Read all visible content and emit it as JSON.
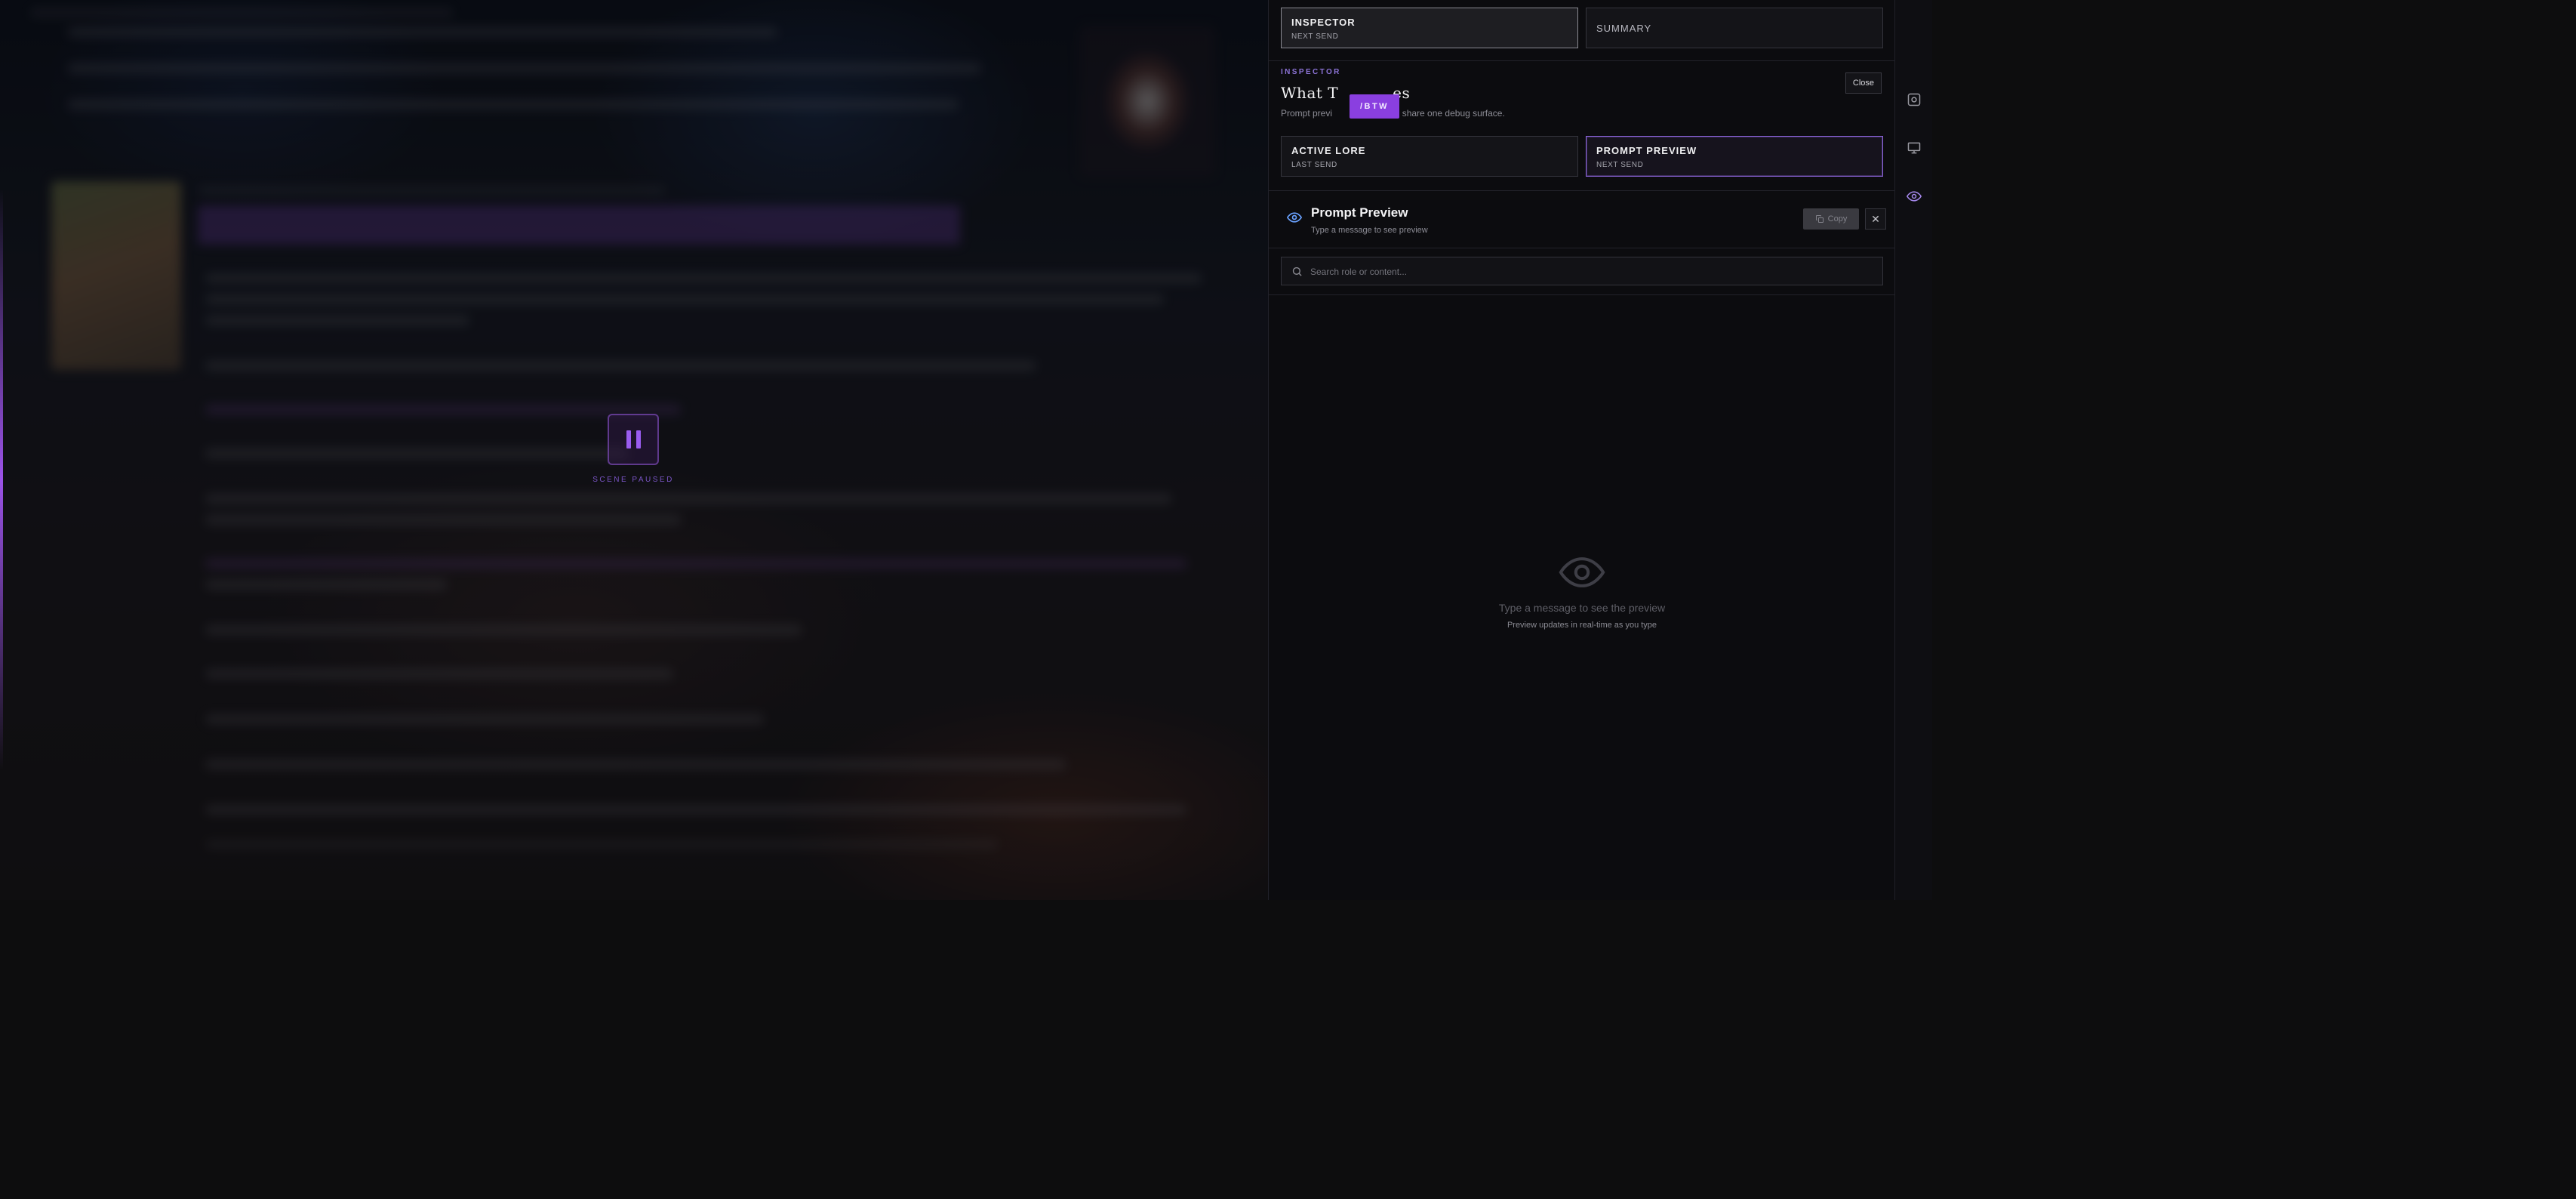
{
  "background": {
    "scene_status": "SCENE PAUSED"
  },
  "inspector": {
    "tabs_top": [
      {
        "label": "INSPECTOR",
        "sublabel": "NEXT SEND",
        "selected": true
      },
      {
        "label": "SUMMARY",
        "sublabel": "",
        "selected": false
      }
    ],
    "eyebrow": "INSPECTOR",
    "title_start": "What T",
    "title_end": "es",
    "intro_start": "Prompt previ",
    "intro_end": "ore share one debug surface.",
    "btw_badge": "/BTW",
    "close_label": "Close",
    "tabs_mid": [
      {
        "label": "ACTIVE LORE",
        "sublabel": "LAST SEND",
        "selected": false
      },
      {
        "label": "PROMPT PREVIEW",
        "sublabel": "NEXT SEND",
        "selected": true
      }
    ]
  },
  "prompt_preview": {
    "title": "Prompt Preview",
    "subtitle": "Type a message to see preview",
    "copy_label": "Copy",
    "close_glyph": "✕",
    "search_placeholder": "Search role or content...",
    "search_value": "",
    "empty_title": "Type a message to see the preview",
    "empty_subtitle": "Preview updates in real-time as you type"
  },
  "rail": {
    "items": [
      {
        "icon": "settings-box-icon",
        "active": false
      },
      {
        "icon": "monitor-icon",
        "active": false
      },
      {
        "icon": "eye-icon",
        "active": true
      }
    ]
  },
  "colors": {
    "accent": "#8a3fe0",
    "selected_border": "#8a63d8",
    "preview_icon": "#6aa2ff"
  }
}
